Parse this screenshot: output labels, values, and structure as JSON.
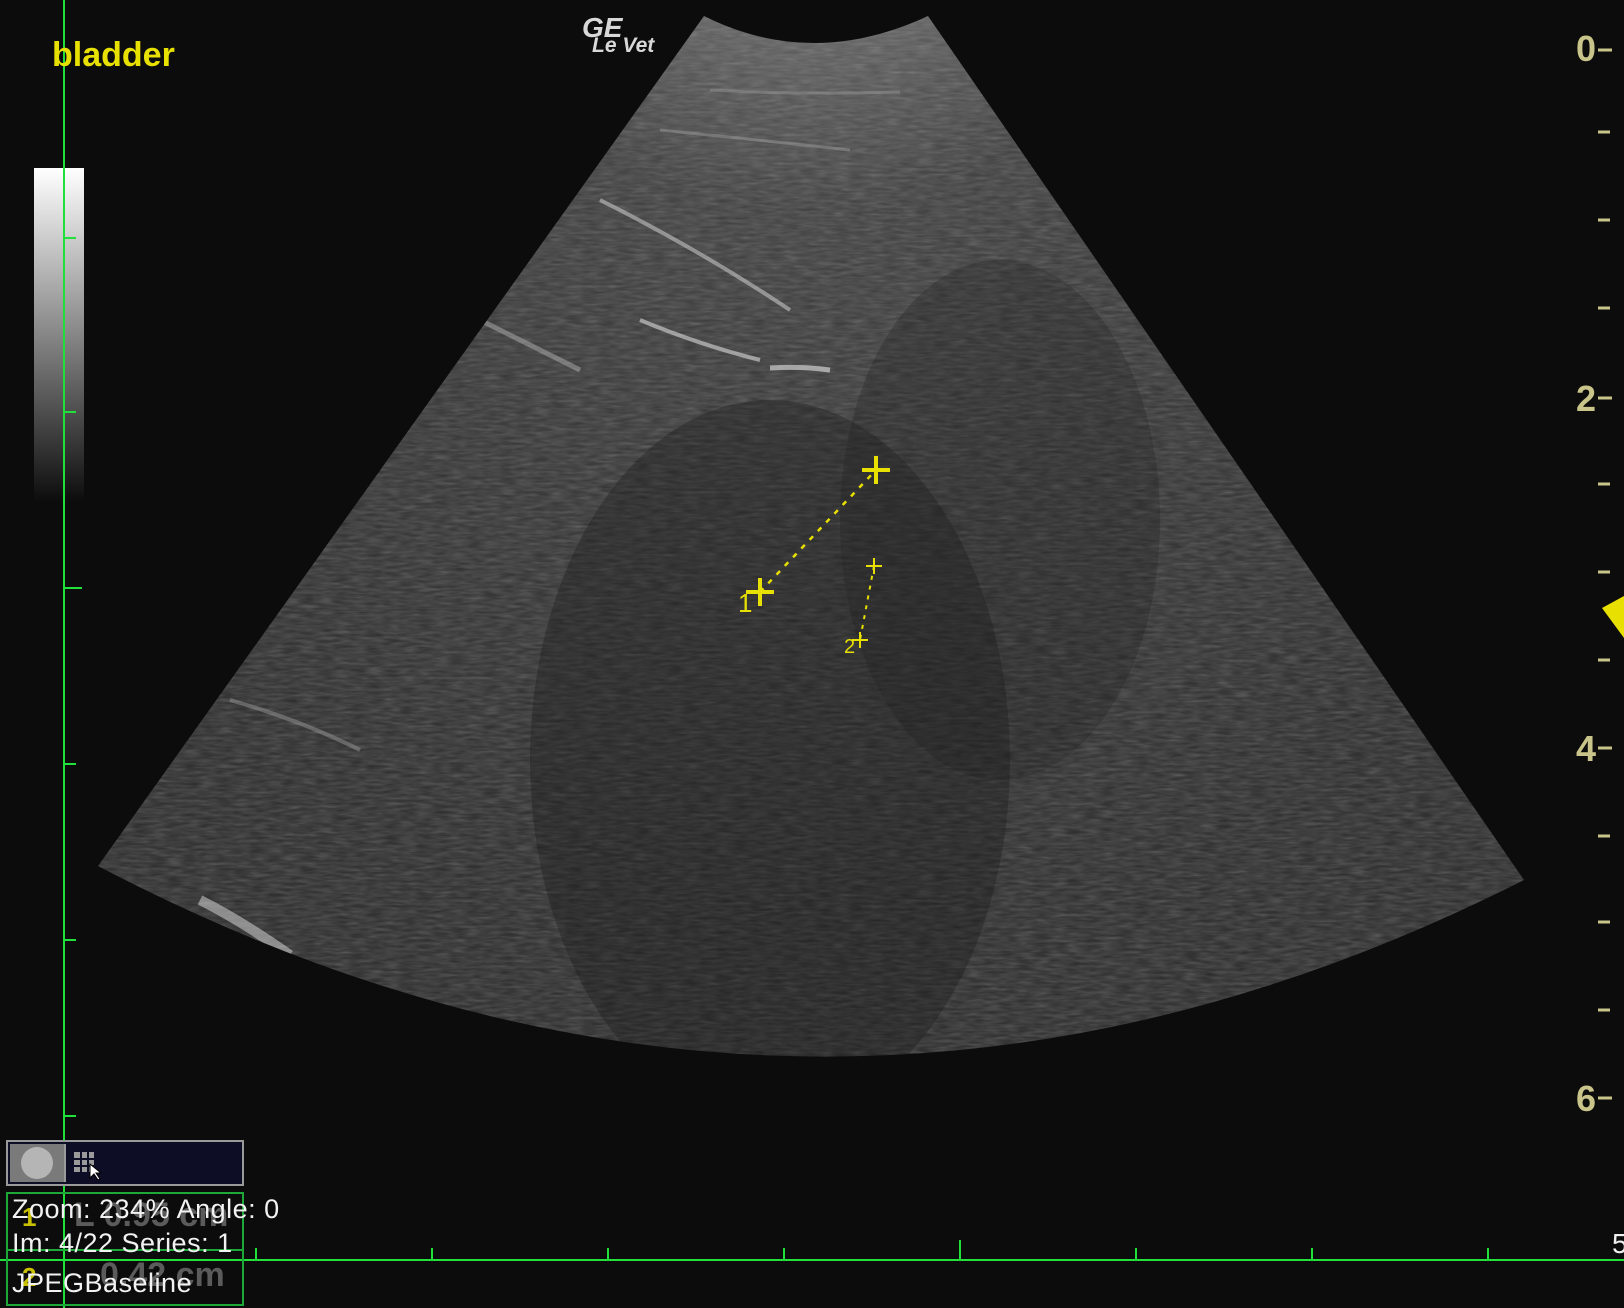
{
  "annotation": {
    "organ_label": "bladder"
  },
  "brand": {
    "line1": "GE",
    "line2": "Le Vet"
  },
  "depth_scale": {
    "labels": [
      "0",
      "2",
      "4",
      "6"
    ]
  },
  "bottom_scale": {
    "end_label": "5"
  },
  "calipers": {
    "marker1": "1",
    "marker2": "2"
  },
  "measurements": [
    {
      "index": "1",
      "value": "L 0.95 cm"
    },
    {
      "index": "2",
      "value": "0.42 cm"
    }
  ],
  "info": {
    "zoom_line": "Zoom: 234% Angle: 0",
    "image_line": "Im: 4/22   Series:  1",
    "format_line": "JPEGBaseline"
  },
  "colors": {
    "caliper": "#e8e000",
    "grid": "#22e03a",
    "depth_text": "#c9c48a"
  }
}
